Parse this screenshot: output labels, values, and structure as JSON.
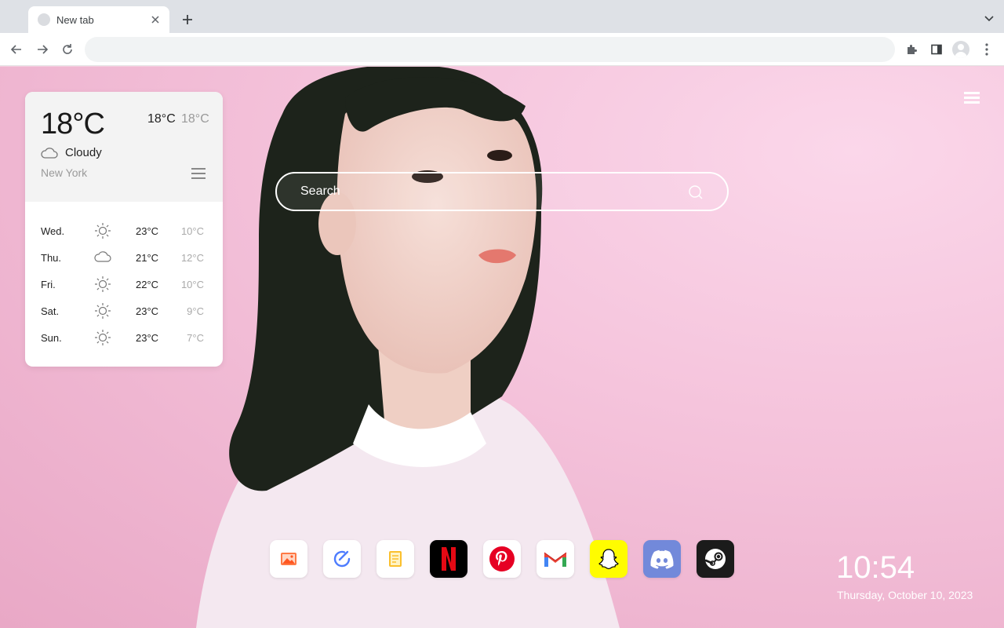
{
  "browser": {
    "tab_title": "New tab",
    "address_value": "",
    "address_placeholder": ""
  },
  "weather": {
    "current_temp": "18°C",
    "high": "18°C",
    "low": "18°C",
    "condition": "Cloudy",
    "condition_icon": "cloud-icon",
    "city": "New York",
    "forecast": [
      {
        "day": "Wed.",
        "icon": "sun-icon",
        "high": "23°C",
        "low": "10°C"
      },
      {
        "day": "Thu.",
        "icon": "cloud-icon",
        "high": "21°C",
        "low": "12°C"
      },
      {
        "day": "Fri.",
        "icon": "sun-icon",
        "high": "22°C",
        "low": "10°C"
      },
      {
        "day": "Sat.",
        "icon": "sun-icon",
        "high": "23°C",
        "low": "9°C"
      },
      {
        "day": "Sun.",
        "icon": "sun-icon",
        "high": "23°C",
        "low": "7°C"
      }
    ]
  },
  "search": {
    "placeholder": "Search"
  },
  "shortcuts": [
    {
      "name": "gallery",
      "icon": "image-icon",
      "bg": "#ffffff"
    },
    {
      "name": "tasks",
      "icon": "check-circle-icon",
      "bg": "#ffffff"
    },
    {
      "name": "notes",
      "icon": "note-icon",
      "bg": "#ffffff"
    },
    {
      "name": "netflix",
      "icon": "netflix-icon",
      "bg": "#000000"
    },
    {
      "name": "pinterest",
      "icon": "pinterest-icon",
      "bg": "#ffffff"
    },
    {
      "name": "gmail",
      "icon": "gmail-icon",
      "bg": "#ffffff"
    },
    {
      "name": "snapchat",
      "icon": "snapchat-icon",
      "bg": "#fffc00"
    },
    {
      "name": "discord",
      "icon": "discord-icon",
      "bg": "#7289da"
    },
    {
      "name": "steam",
      "icon": "steam-icon",
      "bg": "#1b1b1b"
    }
  ],
  "clock": {
    "time": "10:54",
    "date": "Thursday, October 10, 2023"
  },
  "colors": {
    "page_bg": "#f4cfe0",
    "netflix_red": "#e50914",
    "pinterest_red": "#e60023",
    "discord_blurple": "#7289da",
    "snapchat_yellow": "#fffc00"
  }
}
